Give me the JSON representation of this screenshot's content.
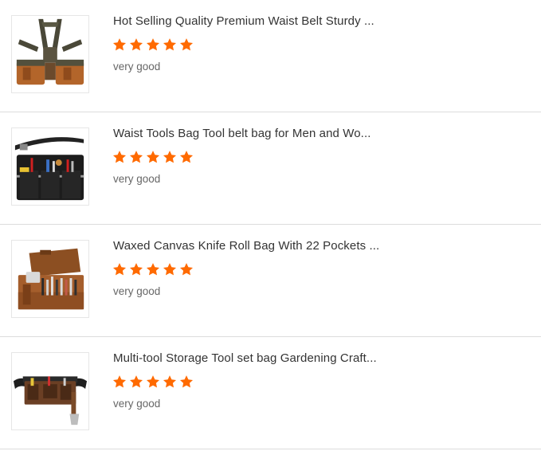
{
  "theme": {
    "star_color": "#ff6a00",
    "title_color": "#333333",
    "comment_color": "#666666",
    "divider_color": "#dcdcdc"
  },
  "reviews": [
    {
      "title": "Hot Selling Quality Premium Waist Belt Sturdy ...",
      "rating": 5,
      "comment": "very good",
      "image_icon": "tool-vest-bag-image"
    },
    {
      "title": "Waist Tools Bag Tool belt bag for Men and Wo...",
      "rating": 5,
      "comment": "very good",
      "image_icon": "waist-tool-pouch-image"
    },
    {
      "title": "Waxed Canvas Knife Roll Bag With 22 Pockets ...",
      "rating": 5,
      "comment": "very good",
      "image_icon": "knife-roll-bag-image"
    },
    {
      "title": "Multi-tool Storage Tool set bag Gardening Craft...",
      "rating": 5,
      "comment": "very good",
      "image_icon": "tool-belt-bag-image"
    }
  ]
}
